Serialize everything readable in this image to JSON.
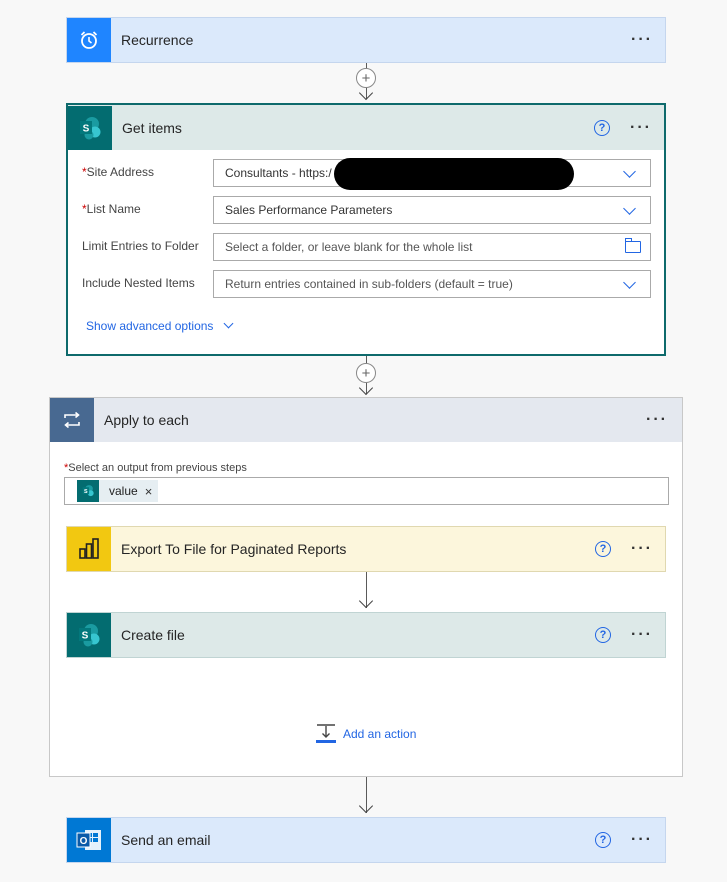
{
  "recurrence": {
    "title": "Recurrence",
    "more": "···"
  },
  "get_items": {
    "title": "Get items",
    "help": "?",
    "more": "···",
    "fields": [
      {
        "label": "Site Address",
        "required": "*",
        "value": "Consultants - https:/"
      },
      {
        "label": "List Name",
        "required": "*",
        "value": "Sales Performance Parameters"
      },
      {
        "label": "Limit Entries to Folder",
        "value": "Select a folder, or leave blank for the whole list"
      },
      {
        "label": "Include Nested Items",
        "value": "Return entries contained in sub-folders (default = true)"
      }
    ],
    "advanced": "Show advanced options"
  },
  "apply_each": {
    "title": "Apply to each",
    "more": "···",
    "output_label": "Select an output from previous steps",
    "required": "*",
    "token": "value",
    "token_remove": "×"
  },
  "export": {
    "title": "Export To File for Paginated Reports",
    "help": "?",
    "more": "···"
  },
  "create_file": {
    "title": "Create file",
    "help": "?",
    "more": "···"
  },
  "add_action": "Add an action",
  "send_email": {
    "title": "Send an email",
    "help": "?",
    "more": "···"
  },
  "colors": {
    "recurrence_icon": "#1f85ff",
    "sharepoint": "#036c70",
    "powerbi": "#f2c811",
    "outlook": "#0078d4",
    "loop": "#486991",
    "accent": "#2266e3"
  },
  "icons": [
    "alarm-clock-icon",
    "sharepoint-icon",
    "powerbi-icon",
    "outlook-icon",
    "loop-icon",
    "folder-icon",
    "chevron-down-icon",
    "add-action-icon"
  ]
}
